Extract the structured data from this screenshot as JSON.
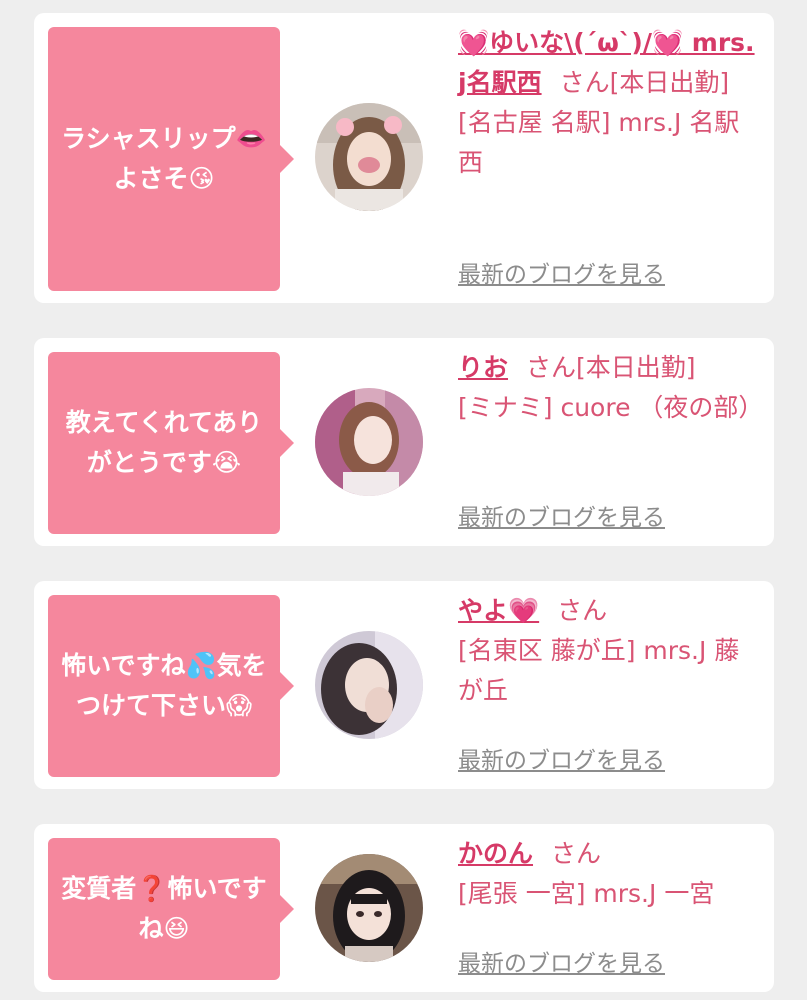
{
  "posts": [
    {
      "comment": "ラシャスリップ👄よさそ😘",
      "name": "💓ゆいな\\(´ω`)/💓 mrs.j名駅西",
      "status": "さん[本日出勤]",
      "shop": "[名古屋 名駅] mrs.J 名駅西",
      "blog_link": "最新のブログを見る"
    },
    {
      "comment": "教えてくれてありがとうです😭",
      "name": "りお",
      "status": "さん[本日出勤]",
      "shop": "[ミナミ] cuore （夜の部）",
      "blog_link": "最新のブログを見る"
    },
    {
      "comment": "怖いですね💦気をつけて下さい😱",
      "name": "やよ💗",
      "status": "さん",
      "shop": "[名東区 藤が丘] mrs.J 藤が丘",
      "blog_link": "最新のブログを見る"
    },
    {
      "comment": "変質者❓怖いですね😆",
      "name": "かのん",
      "status": "さん",
      "shop": "[尾張 一宮] mrs.J 一宮",
      "blog_link": "最新のブログを見る"
    }
  ],
  "colors": {
    "bubble": "#f5879d",
    "name": "#d63a67",
    "text": "#d95474",
    "link": "#8c8c8c",
    "background": "#eeeeee"
  }
}
